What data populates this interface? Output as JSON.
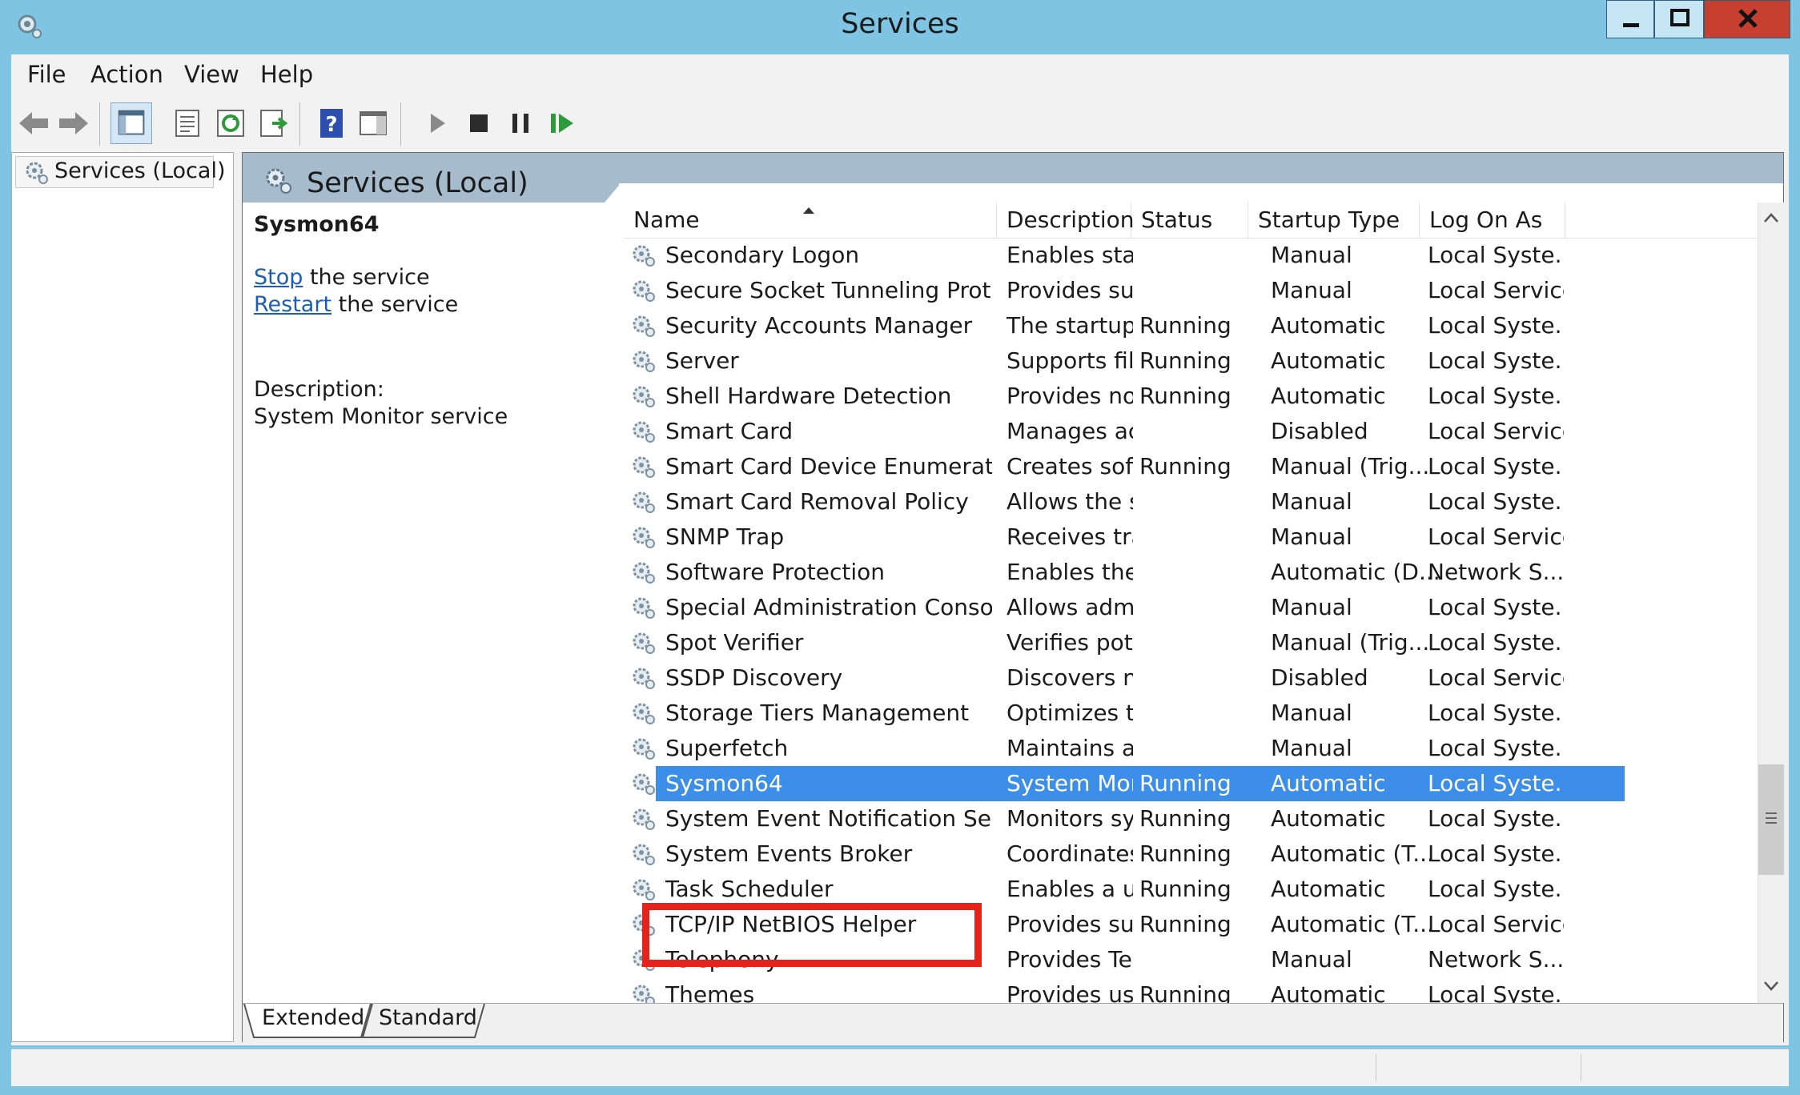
{
  "window": {
    "title": "Services"
  },
  "menu": [
    "File",
    "Action",
    "View",
    "Help"
  ],
  "tree": {
    "item_label": "Services (Local)"
  },
  "pane": {
    "title": "Services (Local)"
  },
  "detail": {
    "service_name": "Sysmon64",
    "stop_link": "Stop",
    "stop_suffix": " the service",
    "restart_link": "Restart",
    "restart_suffix": " the service",
    "description_label": "Description:",
    "description_text": "System Monitor service"
  },
  "columns": [
    "Name",
    "Description",
    "Status",
    "Startup Type",
    "Log On As"
  ],
  "services": [
    {
      "name": "Secondary Logon",
      "description": "Enables startin...",
      "status": "",
      "startup": "Manual",
      "logon": "Local Syste..."
    },
    {
      "name": "Secure Socket Tunneling Protoc...",
      "description": "Provides suppo...",
      "status": "",
      "startup": "Manual",
      "logon": "Local Service"
    },
    {
      "name": "Security Accounts Manager",
      "description": "The startup of t...",
      "status": "Running",
      "startup": "Automatic",
      "logon": "Local Syste..."
    },
    {
      "name": "Server",
      "description": "Supports file, p...",
      "status": "Running",
      "startup": "Automatic",
      "logon": "Local Syste..."
    },
    {
      "name": "Shell Hardware Detection",
      "description": "Provides notific...",
      "status": "Running",
      "startup": "Automatic",
      "logon": "Local Syste..."
    },
    {
      "name": "Smart Card",
      "description": "Manages acces...",
      "status": "",
      "startup": "Disabled",
      "logon": "Local Service"
    },
    {
      "name": "Smart Card Device Enumeration...",
      "description": "Creates softwar...",
      "status": "Running",
      "startup": "Manual (Trig...",
      "logon": "Local Syste..."
    },
    {
      "name": "Smart Card Removal Policy",
      "description": "Allows the syst...",
      "status": "",
      "startup": "Manual",
      "logon": "Local Syste..."
    },
    {
      "name": "SNMP Trap",
      "description": "Receives trap ...",
      "status": "",
      "startup": "Manual",
      "logon": "Local Service"
    },
    {
      "name": "Software Protection",
      "description": "Enables the do...",
      "status": "",
      "startup": "Automatic (D...",
      "logon": "Network S..."
    },
    {
      "name": "Special Administration Console ...",
      "description": "Allows adminis...",
      "status": "",
      "startup": "Manual",
      "logon": "Local Syste..."
    },
    {
      "name": "Spot Verifier",
      "description": "Verifies potenti...",
      "status": "",
      "startup": "Manual (Trig...",
      "logon": "Local Syste..."
    },
    {
      "name": "SSDP Discovery",
      "description": "Discovers netw...",
      "status": "",
      "startup": "Disabled",
      "logon": "Local Service"
    },
    {
      "name": "Storage Tiers Management",
      "description": "Optimizes the ...",
      "status": "",
      "startup": "Manual",
      "logon": "Local Syste..."
    },
    {
      "name": "Superfetch",
      "description": "Maintains and i...",
      "status": "",
      "startup": "Manual",
      "logon": "Local Syste..."
    },
    {
      "name": "Sysmon64",
      "description": "System Monito...",
      "status": "Running",
      "startup": "Automatic",
      "logon": "Local Syste...",
      "selected": true
    },
    {
      "name": "System Event Notification Service",
      "description": "Monitors syste...",
      "status": "Running",
      "startup": "Automatic",
      "logon": "Local Syste..."
    },
    {
      "name": "System Events Broker",
      "description": "Coordinates ex...",
      "status": "Running",
      "startup": "Automatic (T...",
      "logon": "Local Syste..."
    },
    {
      "name": "Task Scheduler",
      "description": "Enables a user t...",
      "status": "Running",
      "startup": "Automatic",
      "logon": "Local Syste..."
    },
    {
      "name": "TCP/IP NetBIOS Helper",
      "description": "Provides suppo...",
      "status": "Running",
      "startup": "Automatic (T...",
      "logon": "Local Service"
    },
    {
      "name": "Telephony",
      "description": "Provides Telep...",
      "status": "",
      "startup": "Manual",
      "logon": "Network S..."
    },
    {
      "name": "Themes",
      "description": "Provides user e...",
      "status": "Running",
      "startup": "Automatic",
      "logon": "Local Syste..."
    }
  ],
  "tabs": [
    "Extended",
    "Standard"
  ],
  "colors": {
    "selection": "#3c8ee8",
    "highlight_box": "#e5231b",
    "title_bar": "#7fc4e3",
    "pane_header": "#a6bccd"
  }
}
